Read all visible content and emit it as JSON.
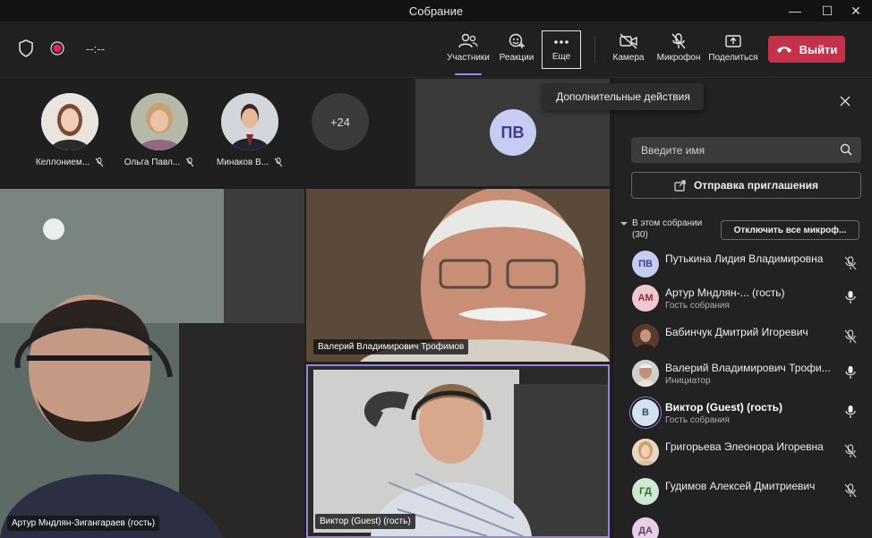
{
  "window": {
    "title": "Собрание",
    "minimize": "—",
    "maximize": "☐",
    "close": "✕"
  },
  "toolbar": {
    "timer": "--:--",
    "participants": "Участники",
    "reactions": "Реакции",
    "more": "Еще",
    "camera": "Камера",
    "mic": "Микрофон",
    "share": "Поделиться",
    "leave": "Выйти"
  },
  "tooltip": "Дополнительные действия",
  "avatars": [
    {
      "name": "Келлонием..."
    },
    {
      "name": "Ольга Павл..."
    },
    {
      "name": "Минаков В..."
    }
  ],
  "more_count": "+24",
  "pv_tile": {
    "initials": "ПВ"
  },
  "videos": [
    {
      "label": "Артур Мндлян-Зигангараев (гость)"
    },
    {
      "label": "Валерий Владимирович Трофимов"
    },
    {
      "label": "Виктор (Guest) (гость)"
    }
  ],
  "panel": {
    "search_placeholder": "Введите имя",
    "invite": "Отправка приглашения",
    "section_title": "В этом собрании",
    "section_count": "(30)",
    "mute_all": "Отключить все микроф...",
    "people": [
      {
        "initials": "ПВ",
        "name": "Путькина Лидия Владимировна",
        "role": "",
        "mic": "muted",
        "bold": false,
        "color": "#c8cbf2",
        "fg": "#3c3f8c"
      },
      {
        "initials": "АМ",
        "name": "Артур Мндлян-...  (гость)",
        "role": "Гость собрания",
        "mic": "on",
        "bold": false,
        "color": "#f2c8cf",
        "fg": "#8c2f3f"
      },
      {
        "initials": "",
        "name": "Бабинчук Дмитрий Игоревич",
        "role": "",
        "mic": "muted",
        "bold": false,
        "color": "#6b4a3a",
        "fg": "#fff"
      },
      {
        "initials": "",
        "name": "Валерий Владимирович Трофи...",
        "role": "Инициатор",
        "mic": "on",
        "bold": false,
        "color": "#d8d8d8",
        "fg": "#fff"
      },
      {
        "initials": "В",
        "name": "Виктор (Guest) (гость)",
        "role": "Гость собрания",
        "mic": "on",
        "bold": true,
        "color": "#d5e3ef",
        "fg": "#2b4d6a"
      },
      {
        "initials": "",
        "name": "Григорьева Элеонора Игоревна",
        "role": "",
        "mic": "muted",
        "bold": false,
        "color": "#c9a27a",
        "fg": "#fff"
      },
      {
        "initials": "ГД",
        "name": "Гудимов Алексей Дмитриевич",
        "role": "",
        "mic": "muted",
        "bold": false,
        "color": "#cfe8d2",
        "fg": "#2f6b3a"
      },
      {
        "initials": "ДА",
        "name": "",
        "role": "",
        "mic": "",
        "bold": false,
        "color": "#e6d0e8",
        "fg": "#6b3a70"
      }
    ]
  }
}
